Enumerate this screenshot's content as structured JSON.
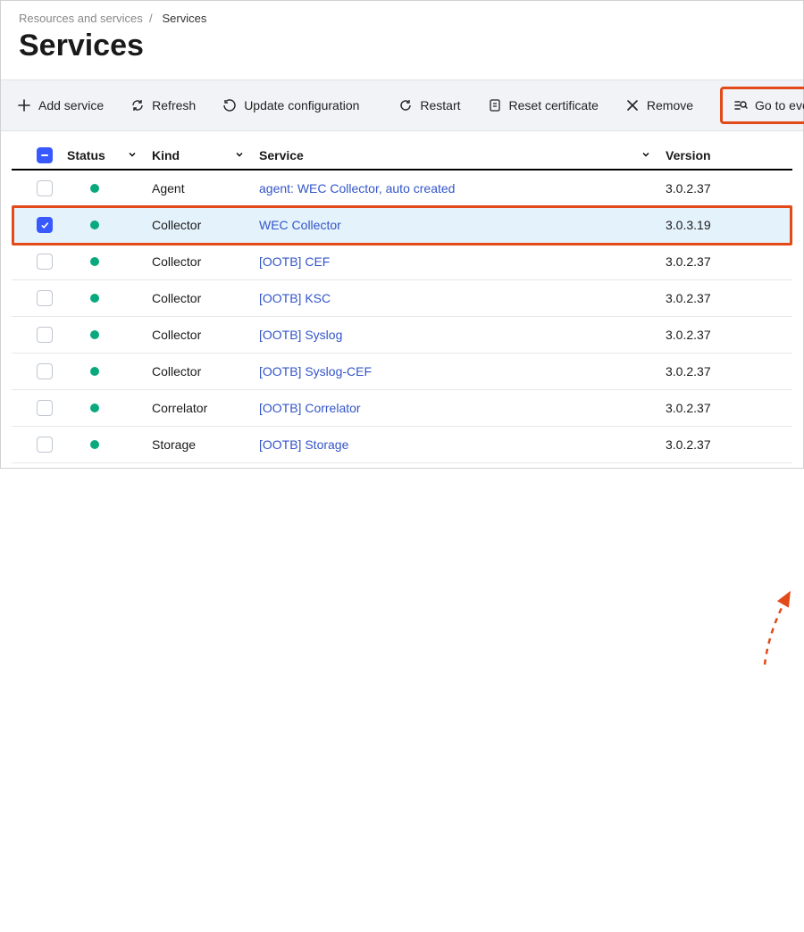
{
  "breadcrumb": {
    "root": "Resources and services",
    "sep": "/",
    "current": "Services"
  },
  "title": "Services",
  "toolbar": {
    "add": "Add service",
    "refresh": "Refresh",
    "update": "Update configuration",
    "restart": "Restart",
    "reset": "Reset certificate",
    "remove": "Remove",
    "events": "Go to events"
  },
  "columns": {
    "status": "Status",
    "kind": "Kind",
    "service": "Service",
    "version": "Version"
  },
  "rows": [
    {
      "checked": false,
      "status": "ok",
      "kind": "Agent",
      "service": "agent: WEC Collector, auto created",
      "version": "3.0.2.37"
    },
    {
      "checked": true,
      "status": "ok",
      "kind": "Collector",
      "service": "WEC Collector",
      "version": "3.0.3.19"
    },
    {
      "checked": false,
      "status": "ok",
      "kind": "Collector",
      "service": "[OOTB] CEF",
      "version": "3.0.2.37"
    },
    {
      "checked": false,
      "status": "ok",
      "kind": "Collector",
      "service": "[OOTB] KSC",
      "version": "3.0.2.37"
    },
    {
      "checked": false,
      "status": "ok",
      "kind": "Collector",
      "service": "[OOTB] Syslog",
      "version": "3.0.2.37"
    },
    {
      "checked": false,
      "status": "ok",
      "kind": "Collector",
      "service": "[OOTB] Syslog-CEF",
      "version": "3.0.2.37"
    },
    {
      "checked": false,
      "status": "ok",
      "kind": "Correlator",
      "service": "[OOTB] Correlator",
      "version": "3.0.2.37"
    },
    {
      "checked": false,
      "status": "ok",
      "kind": "Storage",
      "service": "[OOTB] Storage",
      "version": "3.0.2.37"
    }
  ],
  "colors": {
    "accent": "#3859ff",
    "highlight": "#e24a1a",
    "ok": "#0aa97d",
    "link": "#3355c8"
  }
}
